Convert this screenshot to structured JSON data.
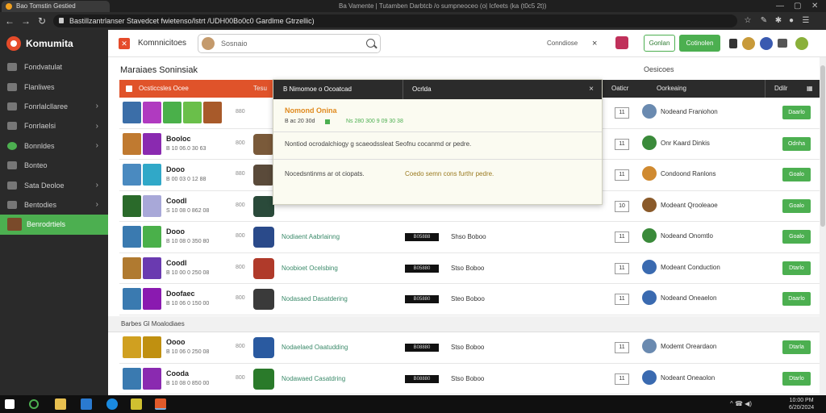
{
  "browser": {
    "tab_title": "Bao Tomstin Gestied",
    "window_title": "Ba  Vamente | Tutamben Darbtcb /o sumpneoceo (o| Icfeets (ka (t0c5 2t))",
    "url": "Bastillzantrlanser Stavedcet fwietenso/lstrt /UDH00Bo0c0 Gardlme Gtrzellic)"
  },
  "sidebar": {
    "brand": "Komumita",
    "items": [
      {
        "label": "Fondvatulat",
        "chevron": false,
        "active": false
      },
      {
        "label": "Flanliwes",
        "chevron": false,
        "active": false
      },
      {
        "label": "Fonrlalcllaree",
        "chevron": true,
        "active": false
      },
      {
        "label": "Fonrlaelsi",
        "chevron": true,
        "active": false
      },
      {
        "label": "Bonnldes",
        "chevron": true,
        "active": false
      },
      {
        "label": "Bonteo",
        "chevron": false,
        "active": false
      },
      {
        "label": "Sata Deoloe",
        "chevron": true,
        "active": false
      },
      {
        "label": "Bentodies",
        "chevron": true,
        "active": false
      },
      {
        "label": "Benrodrtiels",
        "chevron": false,
        "active": true
      }
    ]
  },
  "header": {
    "title": "Komnnicitoes",
    "search_placeholder": "Sosnaio",
    "label": "Conndiose",
    "close": "×",
    "btn_outline": "Gonlan",
    "btn_green": "Cotinolen"
  },
  "main": {
    "page_title": "Maraiaes Soninsiak",
    "right_label": "Oesicoes",
    "columns": {
      "c1": "Ocsticcsles Ocee",
      "c2": "Tesu",
      "c3": "Oaticr",
      "c4": "Oorkeaing",
      "c5": "Ddilr"
    },
    "section_label": "Barbes Gl Moalodiaes"
  },
  "rows": [
    {
      "name": "",
      "sub": "",
      "size": "880",
      "link": "",
      "bar": "",
      "stat": "",
      "num": "11",
      "user": "Nodeand Franiohon",
      "button": "Daarlo",
      "thumbs": [
        "#3b6ea8",
        "#b03ac0",
        "#4ab04a",
        "#6abf4a",
        "#a85a2a"
      ],
      "avatar": "",
      "user_color": "#6a8ab0"
    },
    {
      "name": "Booloc",
      "sub": "B 10 06.0 30 63",
      "size": "800",
      "link": "",
      "bar": "",
      "stat": "",
      "num": "11",
      "user": "Onr Kaard Dinkis",
      "button": "Odnha",
      "thumbs": [
        "#c07a30",
        "#8a2ab0"
      ],
      "avatar": "#7a5a3a",
      "user_color": "#3a8a3a"
    },
    {
      "name": "Dooo",
      "sub": "B 00 03 0 12 88",
      "size": "880",
      "link": "",
      "bar": "",
      "stat": "",
      "num": "11",
      "user": "Condoond Ranlons",
      "button": "Goalo",
      "thumbs": [
        "#4a8ac0",
        "#30a8c8"
      ],
      "avatar": "#5a4a3a",
      "user_color": "#d08a30"
    },
    {
      "name": "Coodl",
      "sub": "S 10 08 0 862 08",
      "size": "800",
      "link": "",
      "bar": "",
      "stat": "",
      "num": "10",
      "user": "Modeant Qrooleaoe",
      "button": "Goalo",
      "thumbs": [
        "#2a6a2a",
        "#a8a8d8"
      ],
      "avatar": "#2a4a3a",
      "user_color": "#8a5a2a"
    },
    {
      "name": "Dooo",
      "sub": "B 10 08 0 350 80",
      "size": "800",
      "link": "Nodiaent Aabrlainng",
      "bar": "B05888",
      "stat": "Shso Boboo",
      "num": "11",
      "user": "Nodeand Onomtlo",
      "button": "Goalo",
      "thumbs": [
        "#3a7ab0",
        "#4ab04a"
      ],
      "avatar": "#2a4a8a",
      "user_color": "#3a8a3a"
    },
    {
      "name": "Coodl",
      "sub": "B 10 00 0 250 08",
      "size": "800",
      "link": "Noobioet Ocelsbing",
      "bar": "B05880",
      "stat": "Stso Boboo",
      "num": "11",
      "user": "Modeant Conduction",
      "button": "Dtarlo",
      "thumbs": [
        "#b07a30",
        "#6a3ab0"
      ],
      "avatar": "#b03a2a",
      "user_color": "#3a6ab0"
    },
    {
      "name": "Doofaec",
      "sub": "B 10 06 0 150 00",
      "size": "800",
      "link": "Nodasaed Dasatdering",
      "bar": "B05880",
      "stat": "Steo Boboo",
      "num": "11",
      "user": "Nodeand Oneaelon",
      "button": "Daarlo",
      "thumbs": [
        "#3a7ab0",
        "#8a1ab0"
      ],
      "avatar": "#3a3a3a",
      "user_color": "#3a6ab0"
    },
    {
      "name": "Oooo",
      "sub": "B 10 06 0 250 08",
      "size": "800",
      "link": "Nodaelaed Oaatudding",
      "bar": "B08880",
      "stat": "Stso Boboo",
      "num": "11",
      "user": "Modemt Oreardaon",
      "button": "Dtarla",
      "thumbs": [
        "#d0a020",
        "#c09010"
      ],
      "avatar": "#2a5aa0",
      "user_color": "#6a8ab0"
    },
    {
      "name": "Cooda",
      "sub": "B 10 08 0 850 00",
      "size": "800",
      "link": "Nodawaed Casatdring",
      "bar": "B08880",
      "stat": "Stso Boboo",
      "num": "11",
      "user": "Nodeant Oneaolon",
      "button": "Dtarlo",
      "thumbs": [
        "#3a7ab0",
        "#8a2ab0"
      ],
      "avatar": "#2a7a2a",
      "user_color": "#3a6ab0"
    }
  ],
  "popup": {
    "col1": "B Nimomoe o Ocoatcad",
    "col2": "Ocrlda",
    "close": "×",
    "title": "Nomond Onina",
    "meta1": "B ac 20 30d",
    "meta2": "Ns 280 300 9 09 30 38",
    "desc": "Nontiod ocrodalchiogy g scaeodssleat Seofnu cocanmd or pedre.",
    "foot1": "Nocedsntinms ar ot ciopats.",
    "foot2": "Coedo semn cons furthr pedre."
  },
  "taskbar": {
    "tray": "^  ☎  ◀)",
    "time": "10:00 PM",
    "date": "6/20/2024"
  }
}
